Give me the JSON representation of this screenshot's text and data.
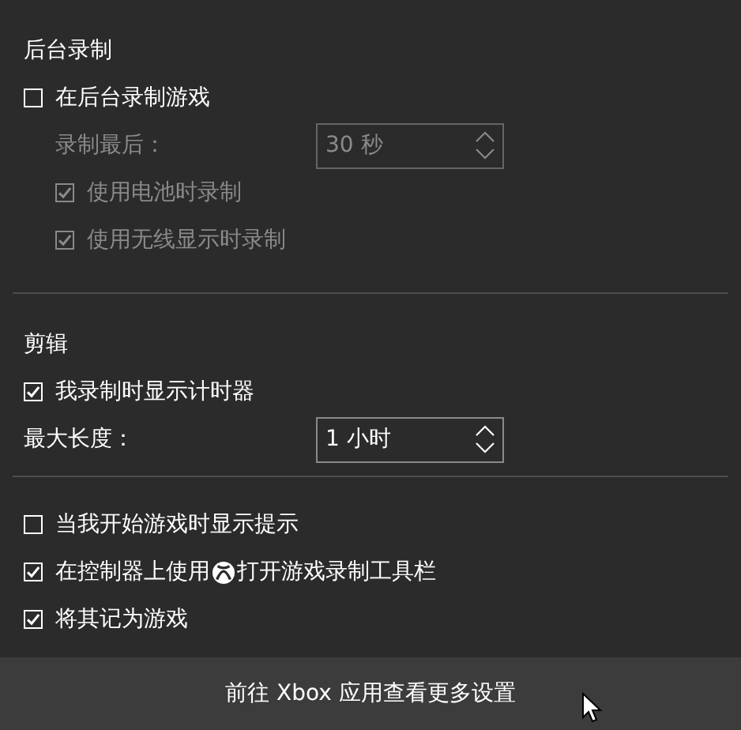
{
  "sections": [
    {
      "title": "后台录制",
      "items": [
        {
          "kind": "checkbox",
          "label": "在后台录制游戏",
          "checked": false,
          "disabled": false,
          "children": [
            {
              "kind": "spinner",
              "label": "录制最后：",
              "value": "30 秒",
              "disabled": true
            },
            {
              "kind": "checkbox",
              "label": "使用电池时录制",
              "checked": true,
              "disabled": true
            },
            {
              "kind": "checkbox",
              "label": "使用无线显示时录制",
              "checked": true,
              "disabled": true
            }
          ]
        }
      ]
    },
    {
      "title": "剪辑",
      "items": [
        {
          "kind": "checkbox",
          "label": "我录制时显示计时器",
          "checked": true,
          "disabled": false
        },
        {
          "kind": "spinner",
          "label": "最大长度：",
          "value": "1 小时",
          "disabled": false
        }
      ]
    },
    {
      "items": [
        {
          "kind": "checkbox",
          "label": "当我开始游戏时显示提示",
          "checked": false,
          "disabled": false
        },
        {
          "kind": "checkbox-xbox",
          "label_before": "在控制器上使用",
          "label_after": "打开游戏录制工具栏",
          "checked": true,
          "disabled": false
        },
        {
          "kind": "checkbox",
          "label": "将其记为游戏",
          "checked": true,
          "disabled": false
        }
      ]
    }
  ],
  "footer": {
    "label": "前往 Xbox 应用查看更多设置"
  }
}
